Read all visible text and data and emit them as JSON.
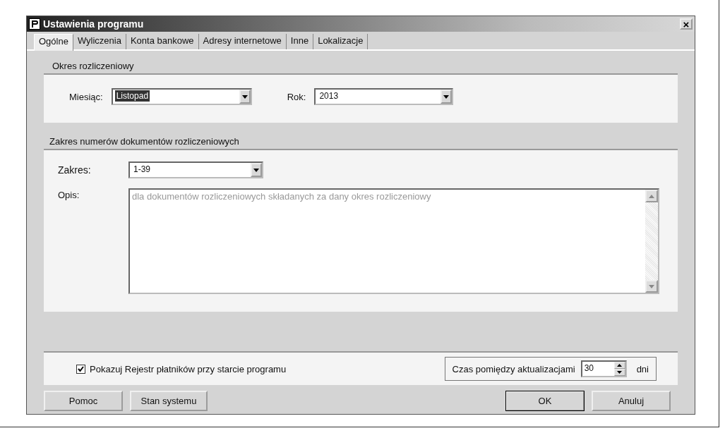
{
  "window": {
    "title": "Ustawienia programu",
    "close": "×"
  },
  "tabs": [
    {
      "label": "Ogólne",
      "selected": true
    },
    {
      "label": "Wyliczenia",
      "selected": false
    },
    {
      "label": "Konta bankowe",
      "selected": false
    },
    {
      "label": "Adresy internetowe",
      "selected": false
    },
    {
      "label": "Inne",
      "selected": false
    },
    {
      "label": "Lokalizacje",
      "selected": false
    }
  ],
  "period": {
    "title": "Okres rozliczeniowy",
    "month_label": "Miesiąc:",
    "month": {
      "value": "Listopad",
      "highlighted": true
    },
    "year_label": "Rok:",
    "year": {
      "value": "2013",
      "highlighted": false
    }
  },
  "range": {
    "title": "Zakres numerów dokumentów rozliczeniowych",
    "range_label": "Zakres:",
    "range": {
      "value": "1-39",
      "highlighted": false
    },
    "description_label": "Opis:",
    "description": "dla dokumentów rozliczeniowych składanych za dany okres rozliczeniowy",
    "description_disabled": true
  },
  "options": {
    "show_register": {
      "label": "Pokazuj Rejestr płatników przy starcie programu",
      "checked": true
    },
    "interval_label": "Czas pomiędzy aktualizacjami",
    "interval": "30",
    "interval_unit": "dni"
  },
  "buttons": [
    {
      "label": "Pomoc",
      "default": false
    },
    {
      "label": "Stan systemu",
      "default": false
    },
    {
      "label": "OK",
      "default": true
    },
    {
      "label": "Anuluj",
      "default": false
    }
  ]
}
